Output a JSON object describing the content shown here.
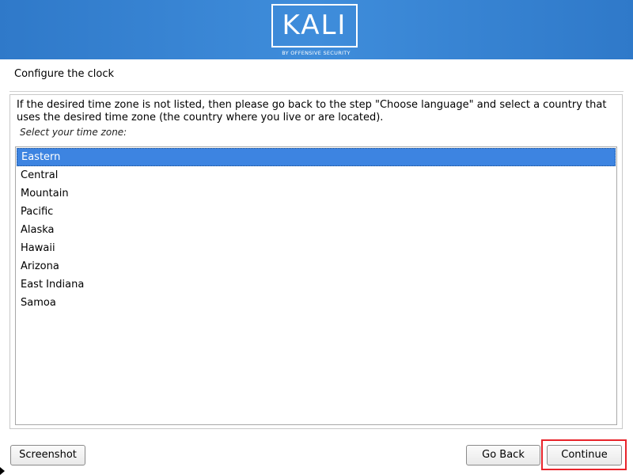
{
  "header": {
    "logo_text": "KALI",
    "logo_subtitle": "BY OFFENSIVE SECURITY",
    "banner_color": "#3a86d6"
  },
  "page": {
    "title": "Configure the clock",
    "description": "If the desired time zone is not listed, then please go back to the step \"Choose language\" and select a country that uses the desired time zone (the country where you live or are located).",
    "prompt": "Select your time zone:"
  },
  "timezones": {
    "selected_index": 0,
    "selection_color": "#3d84e1",
    "items": [
      {
        "label": "Eastern"
      },
      {
        "label": "Central"
      },
      {
        "label": "Mountain"
      },
      {
        "label": "Pacific"
      },
      {
        "label": "Alaska"
      },
      {
        "label": "Hawaii"
      },
      {
        "label": "Arizona"
      },
      {
        "label": "East Indiana"
      },
      {
        "label": "Samoa"
      }
    ]
  },
  "buttons": {
    "screenshot": "Screenshot",
    "go_back": "Go Back",
    "continue": "Continue"
  },
  "annotation": {
    "highlight_color": "#e8242b",
    "highlight_target": "continue"
  }
}
